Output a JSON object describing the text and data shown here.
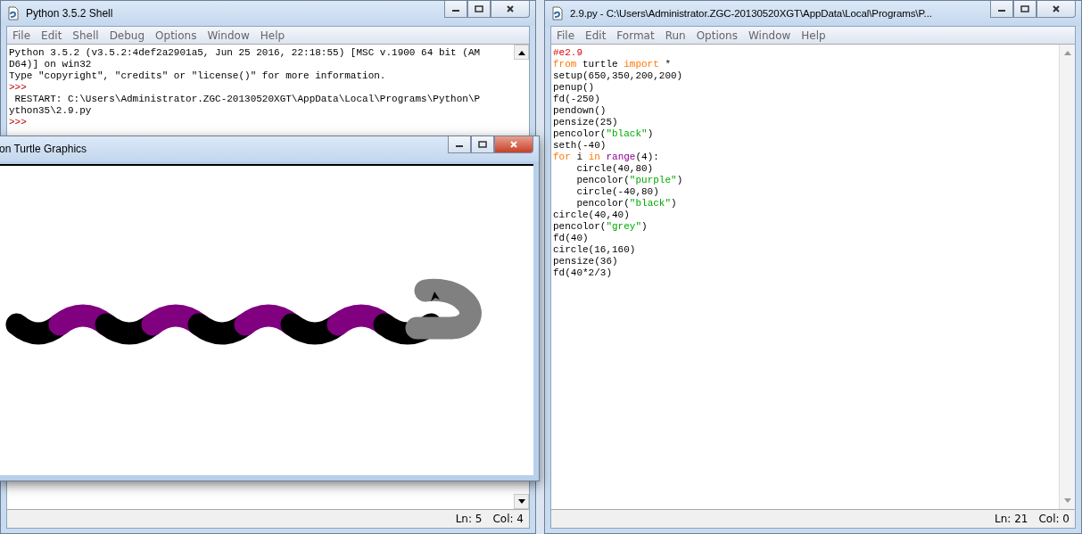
{
  "shell": {
    "title": "Python 3.5.2 Shell",
    "menu": [
      "File",
      "Edit",
      "Shell",
      "Debug",
      "Options",
      "Window",
      "Help"
    ],
    "lines": [
      {
        "text": "Python 3.5.2 (v3.5.2:4def2a2901a5, Jun 25 2016, 22:18:55) [MSC v.1900 64 bit (AM",
        "kind": "output"
      },
      {
        "text": "D64)] on win32",
        "kind": "output"
      },
      {
        "text": "Type \"copyright\", \"credits\" or \"license()\" for more information.",
        "kind": "output"
      },
      {
        "text": ">>>",
        "kind": "prompt"
      },
      {
        "text": " RESTART: C:\\Users\\Administrator.ZGC-20130520XGT\\AppData\\Local\\Programs\\Python\\P",
        "kind": "output"
      },
      {
        "text": "ython35\\2.9.py",
        "kind": "output"
      },
      {
        "text": ">>>",
        "kind": "prompt"
      }
    ],
    "status": {
      "line": "Ln: 5",
      "column": "Col: 4"
    }
  },
  "turtle_window": {
    "title": "on Turtle Graphics"
  },
  "editor": {
    "title": "2.9.py - C:\\Users\\Administrator.ZGC-20130520XGT\\AppData\\Local\\Programs\\P...",
    "menu": [
      "File",
      "Edit",
      "Format",
      "Run",
      "Options",
      "Window",
      "Help"
    ],
    "code": [
      [
        {
          "text": "#e2.9",
          "kind": "comment"
        }
      ],
      [
        {
          "text": "from",
          "kind": "keyword"
        },
        {
          "text": " turtle ",
          "kind": "plain"
        },
        {
          "text": "import",
          "kind": "keyword"
        },
        {
          "text": " *",
          "kind": "plain"
        }
      ],
      [
        {
          "text": "setup(650,350,200,200)",
          "kind": "plain"
        }
      ],
      [
        {
          "text": "penup()",
          "kind": "plain"
        }
      ],
      [
        {
          "text": "fd(-250)",
          "kind": "plain"
        }
      ],
      [
        {
          "text": "pendown()",
          "kind": "plain"
        }
      ],
      [
        {
          "text": "pensize(25)",
          "kind": "plain"
        }
      ],
      [
        {
          "text": "pencolor(",
          "kind": "plain"
        },
        {
          "text": "\"black\"",
          "kind": "string"
        },
        {
          "text": ")",
          "kind": "plain"
        }
      ],
      [
        {
          "text": "seth(-40)",
          "kind": "plain"
        }
      ],
      [
        {
          "text": "for",
          "kind": "keyword"
        },
        {
          "text": " i ",
          "kind": "plain"
        },
        {
          "text": "in",
          "kind": "keyword"
        },
        {
          "text": " range",
          "kind": "builtin"
        },
        {
          "text": "(4):",
          "kind": "plain"
        }
      ],
      [
        {
          "text": "    circle(40,80)",
          "kind": "plain"
        }
      ],
      [
        {
          "text": "    pencolor(",
          "kind": "plain"
        },
        {
          "text": "\"purple\"",
          "kind": "string"
        },
        {
          "text": ")",
          "kind": "plain"
        }
      ],
      [
        {
          "text": "    circle(-40,80)",
          "kind": "plain"
        }
      ],
      [
        {
          "text": "    pencolor(",
          "kind": "plain"
        },
        {
          "text": "\"black\"",
          "kind": "string"
        },
        {
          "text": ")",
          "kind": "plain"
        }
      ],
      [
        {
          "text": "circle(40,40)",
          "kind": "plain"
        }
      ],
      [
        {
          "text": "pencolor(",
          "kind": "plain"
        },
        {
          "text": "\"grey\"",
          "kind": "string"
        },
        {
          "text": ")",
          "kind": "plain"
        }
      ],
      [
        {
          "text": "fd(40)",
          "kind": "plain"
        }
      ],
      [
        {
          "text": "circle(16,160)",
          "kind": "plain"
        }
      ],
      [
        {
          "text": "pensize(36)",
          "kind": "plain"
        }
      ],
      [
        {
          "text": "fd(40*2/3)",
          "kind": "plain"
        }
      ]
    ],
    "status": {
      "line": "Ln: 21",
      "column": "Col: 0"
    }
  }
}
